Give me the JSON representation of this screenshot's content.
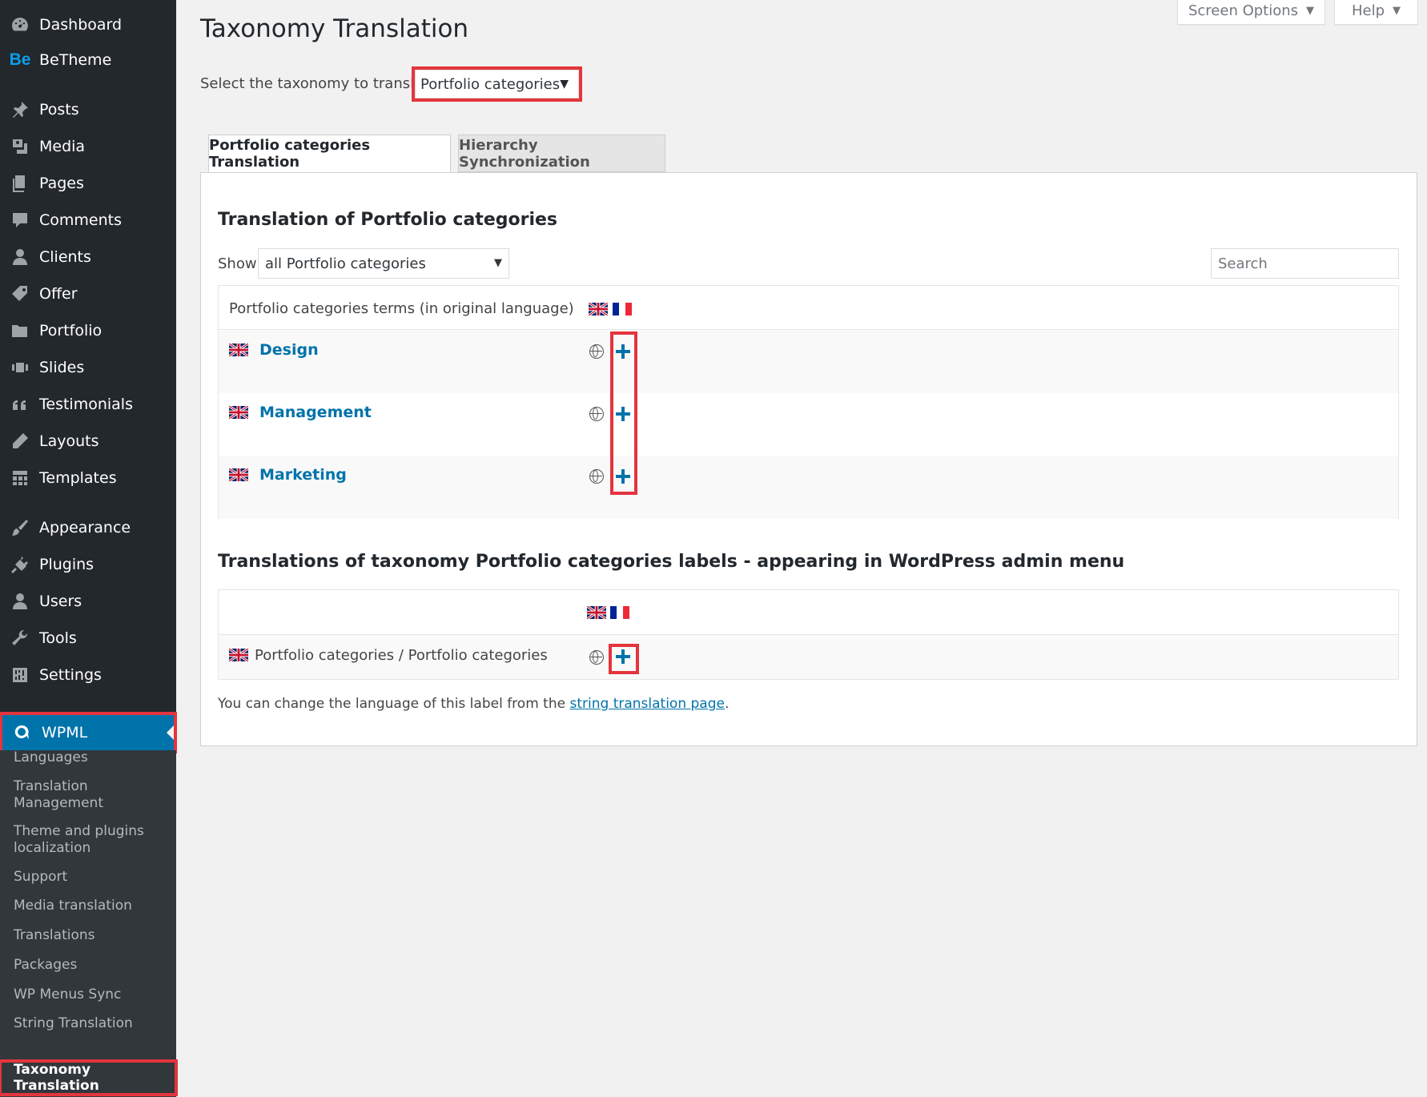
{
  "sidebar": {
    "items": [
      {
        "label": "Dashboard",
        "icon": "dashboard-icon"
      },
      {
        "label": "BeTheme",
        "icon": "betheme-icon",
        "icon_text": "Be"
      },
      {
        "label": "Posts",
        "icon": "pin-icon"
      },
      {
        "label": "Media",
        "icon": "media-icon"
      },
      {
        "label": "Pages",
        "icon": "pages-icon"
      },
      {
        "label": "Comments",
        "icon": "comment-icon"
      },
      {
        "label": "Clients",
        "icon": "person-icon"
      },
      {
        "label": "Offer",
        "icon": "tag-icon"
      },
      {
        "label": "Portfolio",
        "icon": "folder-icon"
      },
      {
        "label": "Slides",
        "icon": "slides-icon"
      },
      {
        "label": "Testimonials",
        "icon": "quote-icon"
      },
      {
        "label": "Layouts",
        "icon": "pencil-icon"
      },
      {
        "label": "Templates",
        "icon": "grid-icon"
      },
      {
        "label": "Appearance",
        "icon": "brush-icon"
      },
      {
        "label": "Plugins",
        "icon": "plug-icon"
      },
      {
        "label": "Users",
        "icon": "user-icon"
      },
      {
        "label": "Tools",
        "icon": "wrench-icon"
      },
      {
        "label": "Settings",
        "icon": "settings-icon"
      }
    ],
    "active": {
      "label": "WPML",
      "icon": "wpml-icon"
    },
    "submenu": [
      "Languages",
      "Translation Management",
      "Theme and plugins localization",
      "Support",
      "Media translation",
      "Translations",
      "Packages",
      "WP Menus Sync",
      "String Translation"
    ],
    "submenu_current": "Taxonomy Translation"
  },
  "screen_options": {
    "screen_options_label": "Screen Options",
    "help_label": "Help"
  },
  "page": {
    "title": "Taxonomy Translation",
    "select_label": "Select the taxonomy to translate:",
    "select_value": "Portfolio categories"
  },
  "tabs": [
    "Portfolio categories Translation",
    "Hierarchy Synchronization"
  ],
  "translation": {
    "heading": "Translation of Portfolio categories",
    "show_label": "Show",
    "show_value": "all Portfolio categories",
    "search_placeholder": "Search",
    "header": "Portfolio categories terms (in original language)",
    "terms": [
      "Design",
      "Management",
      "Marketing"
    ]
  },
  "labels": {
    "heading": "Translations of taxonomy Portfolio categories labels - appearing in WordPress admin menu",
    "row": "Portfolio categories / Portfolio categories",
    "note_prefix": "You can change the language of this label from the",
    "note_link": "string translation page",
    "note_suffix": "."
  },
  "colors": {
    "accent": "#0073aa",
    "highlight": "#e5343d",
    "sidebar": "#23282d"
  }
}
